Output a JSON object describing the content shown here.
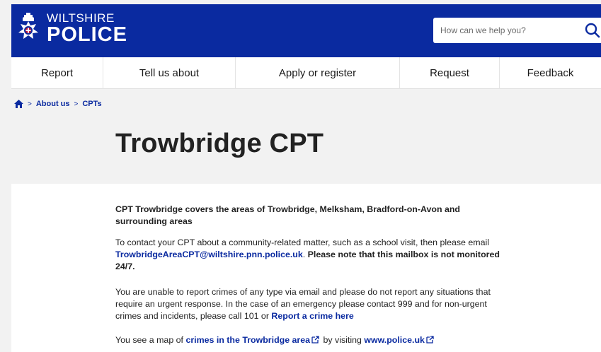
{
  "header": {
    "logo_line1": "WILTSHIRE",
    "logo_line2": "POLICE",
    "search_placeholder": "How can we help you?",
    "brand_color": "#0a2aa0"
  },
  "nav": {
    "items": [
      {
        "label": "Report"
      },
      {
        "label": "Tell us about"
      },
      {
        "label": "Apply or register"
      },
      {
        "label": "Request"
      },
      {
        "label": "Feedback"
      }
    ]
  },
  "breadcrumb": {
    "sep": ">",
    "items": [
      "About us",
      "CPTs"
    ]
  },
  "page": {
    "title": "Trowbridge CPT"
  },
  "content": {
    "p1": "CPT Trowbridge covers the areas of Trowbridge, Melksham, Bradford-on-Avon and surrounding areas",
    "p2_pre": "To contact your CPT about a community-related matter, such as a school visit, then please email ",
    "p2_link": "TrowbridgeAreaCPT@wiltshire.pnn.police.uk",
    "p2_mid": ". ",
    "p2_strong": "Please note that this mailbox is not monitored 24/7.",
    "p3_pre": "You are unable to report crimes of any type via email and please do not report any situations that require an urgent response. In the case of an emergency please contact 999 and for non-urgent crimes and incidents, please call 101 or ",
    "p3_link": "Report a crime here",
    "p4_pre": "You see a map of ",
    "p4_link1": "crimes in the Trowbridge area",
    "p4_mid": " by visiting ",
    "p4_link2": "www.police.uk"
  }
}
